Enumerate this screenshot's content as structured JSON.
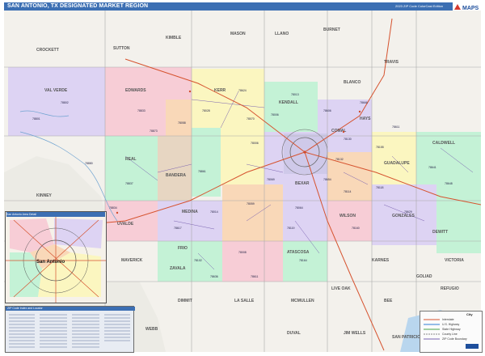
{
  "header": {
    "title": "SAN ANTONIO, TX DESIGNATED MARKET REGION",
    "edition": "2023 ZIP Code ColorCast Edition",
    "logo_text": "MAPS",
    "logo_colors": {
      "red": "#d63a2e",
      "blue": "#1e4f9c"
    }
  },
  "colors": {
    "title_bar": "#3c6fb3",
    "pink": "#f7cdd6",
    "peach": "#f9d8b8",
    "yellow": "#fbf6c0",
    "green": "#c4f2d6",
    "lavender": "#ddd3f3",
    "tan": "#e7d6c2",
    "outside": "#f3f1ec",
    "highway": "#d6532f",
    "water": "#b9d6ee"
  },
  "counties": [
    "CROCKETT",
    "SUTTON",
    "KIMBLE",
    "MASON",
    "LLANO",
    "BURNET",
    "VAL VERDE",
    "EDWARDS",
    "KERR",
    "KENDALL",
    "BLANCO",
    "HAYS",
    "TRAVIS",
    "REAL",
    "BANDERA",
    "COMAL",
    "GUADALUPE",
    "CALDWELL",
    "KINNEY",
    "UVALDE",
    "MEDINA",
    "BEXAR",
    "WILSON",
    "GONZALES",
    "MAVERICK",
    "ZAVALA",
    "FRIO",
    "ATASCOSA",
    "KARNES",
    "DIMMIT",
    "LA SALLE",
    "MCMULLEN",
    "LIVE OAK",
    "BEE",
    "DEWITT",
    "GOLIAD",
    "VICTORIA",
    "DUVAL",
    "JIM WELLS",
    "REFUGIO",
    "SAN PATRICIO",
    "WEBB"
  ],
  "zips": [
    "78802",
    "78801",
    "78833",
    "78873",
    "78058",
    "78028",
    "78006",
    "78013",
    "78070",
    "78606",
    "78624",
    "78666",
    "78130",
    "78132",
    "78155",
    "78611",
    "78006",
    "78641",
    "78880",
    "78837",
    "78861",
    "78069",
    "78114",
    "78118",
    "78160",
    "78648",
    "78629",
    "78834",
    "78617",
    "78014",
    "78059",
    "78064",
    "78119",
    "78008",
    "78102",
    "78164",
    "78611",
    "78636",
    "78654"
  ],
  "inset": {
    "title": "San Antonio Area Detail",
    "city": "San Antonio"
  },
  "index": {
    "title": "ZIP Code Index and Locator"
  },
  "legend": {
    "city_label": "City",
    "items": [
      "Interstate",
      "U.S. Highway",
      "State Highway",
      "County Line",
      "ZIP Code Boundary"
    ]
  }
}
